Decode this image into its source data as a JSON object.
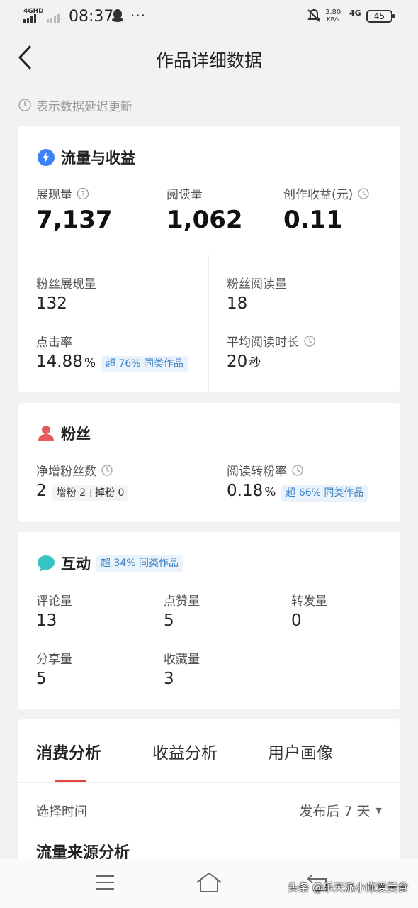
{
  "status_bar": {
    "network_label": "4GHD",
    "time": "08:37",
    "more": "···",
    "speed_value": "3.80",
    "speed_unit": "KB/s",
    "network_type": "4G",
    "battery": "45"
  },
  "nav": {
    "title": "作品详细数据"
  },
  "delay_note": "表示数据延迟更新",
  "traffic": {
    "title": "流量与收益",
    "impressions_label": "展现量",
    "impressions_value": "7,137",
    "reads_label": "阅读量",
    "reads_value": "1,062",
    "earnings_label": "创作收益(元)",
    "earnings_value": "0.11",
    "fan_impressions_label": "粉丝展现量",
    "fan_impressions_value": "132",
    "fan_reads_label": "粉丝阅读量",
    "fan_reads_value": "18",
    "ctr_label": "点击率",
    "ctr_value": "14.88",
    "ctr_unit": "%",
    "ctr_badge": "超 76% 同类作品",
    "avg_read_label": "平均阅读时长",
    "avg_read_value": "20",
    "avg_read_unit": "秒"
  },
  "fans": {
    "title": "粉丝",
    "net_label": "净增粉丝数",
    "net_value": "2",
    "gain_label": "增粉",
    "gain_value": "2",
    "loss_label": "掉粉",
    "loss_value": "0",
    "conv_label": "阅读转粉率",
    "conv_value": "0.18",
    "conv_unit": "%",
    "conv_badge": "超 66% 同类作品"
  },
  "interaction": {
    "title": "互动",
    "badge": "超 34% 同类作品",
    "comments_label": "评论量",
    "comments_value": "13",
    "likes_label": "点赞量",
    "likes_value": "5",
    "reposts_label": "转发量",
    "reposts_value": "0",
    "shares_label": "分享量",
    "shares_value": "5",
    "favorites_label": "收藏量",
    "favorites_value": "3"
  },
  "analysis": {
    "tabs": [
      "消费分析",
      "收益分析",
      "用户画像"
    ],
    "time_label": "选择时间",
    "time_value": "发布后 7 天",
    "source_title": "流量来源分析"
  },
  "watermark": "头条 @乐天派小陈爱美食",
  "colors": {
    "accent_red": "#e54040",
    "badge_blue": "#3b82c4",
    "badge_bg": "#eaf2fb",
    "fans_icon": "#e95b5b",
    "traffic_icon": "#3b82f6",
    "interaction_icon": "#35c3c3"
  }
}
